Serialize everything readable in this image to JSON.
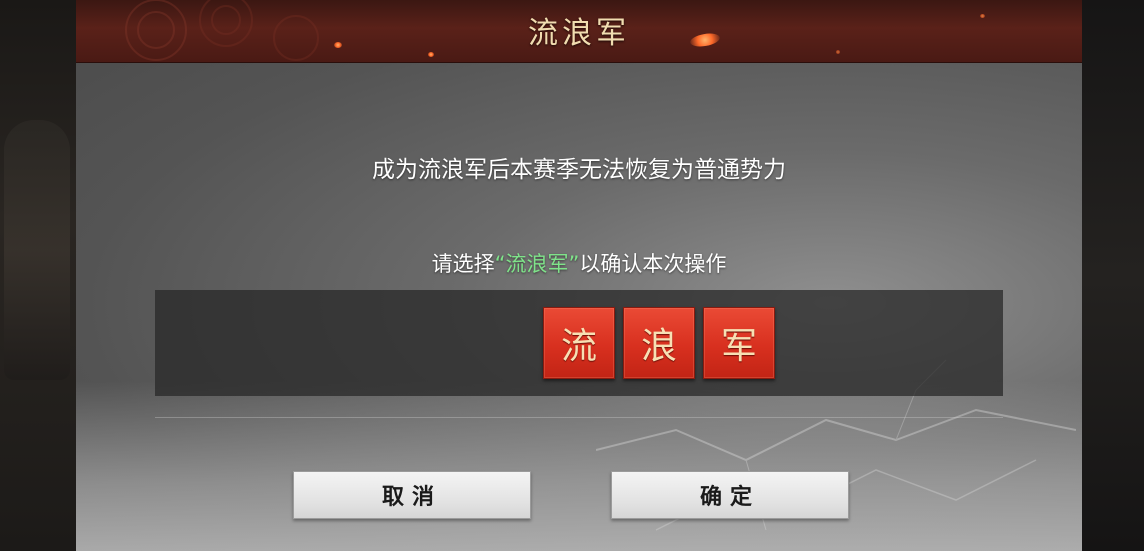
{
  "dialog": {
    "title": "流浪军",
    "warning": "成为流浪军后本赛季无法恢复为普通势力",
    "instruction": {
      "prefix": "请选择",
      "highlight": "“流浪军”",
      "suffix": "以确认本次操作"
    },
    "tiles": [
      {
        "char": "流"
      },
      {
        "char": "浪"
      },
      {
        "char": "军"
      }
    ],
    "buttons": {
      "cancel_label": "取消",
      "confirm_label": "确定"
    }
  },
  "colors": {
    "title_bar": "#5a2119",
    "title_text": "#f1ddb0",
    "highlight": "#7fe38a",
    "tile": "#d8301f",
    "tile_text": "#f7e0b4"
  }
}
